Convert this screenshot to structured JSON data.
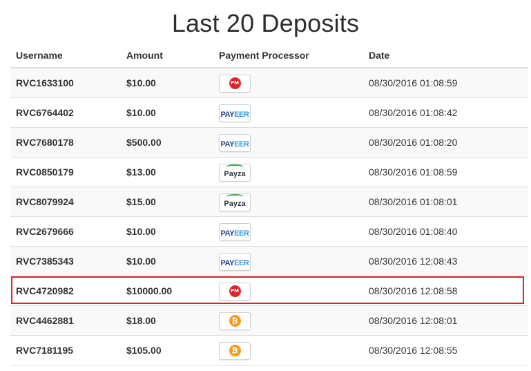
{
  "page": {
    "title": "Last 20 Deposits"
  },
  "table": {
    "headers": {
      "username": "Username",
      "amount": "Amount",
      "processor": "Payment Processor",
      "date": "Date"
    },
    "rows": [
      {
        "username": "RVC1633100",
        "amount": "$10.00",
        "processor": "pm",
        "date": "08/30/2016 01:08:59"
      },
      {
        "username": "RVC6764402",
        "amount": "$10.00",
        "processor": "payeer",
        "date": "08/30/2016 01:08:42"
      },
      {
        "username": "RVC7680178",
        "amount": "$500.00",
        "processor": "payeer",
        "date": "08/30/2016 01:08:20"
      },
      {
        "username": "RVC0850179",
        "amount": "$13.00",
        "processor": "payza",
        "date": "08/30/2016 01:08:59"
      },
      {
        "username": "RVC8079924",
        "amount": "$15.00",
        "processor": "payza",
        "date": "08/30/2016 01:08:01"
      },
      {
        "username": "RVC2679666",
        "amount": "$10.00",
        "processor": "payeer",
        "date": "08/30/2016 01:08:40"
      },
      {
        "username": "RVC7385343",
        "amount": "$10.00",
        "processor": "payeer",
        "date": "08/30/2016 12:08:43"
      },
      {
        "username": "RVC4720982",
        "amount": "$10000.00",
        "processor": "pm",
        "date": "08/30/2016 12:08:58"
      },
      {
        "username": "RVC4462881",
        "amount": "$18.00",
        "processor": "bitcoin",
        "date": "08/30/2016 12:08:01"
      },
      {
        "username": "RVC7181195",
        "amount": "$105.00",
        "processor": "bitcoin",
        "date": "08/30/2016 12:08:55"
      }
    ]
  },
  "processor_logos": {
    "pm": {
      "icon": "perfect-money-logo-icon",
      "text": "PM",
      "color": "#e0232b"
    },
    "payeer": {
      "icon": "payeer-logo-icon",
      "text_a": "PAY",
      "text_b": "EER",
      "color_a": "#1f3f7c",
      "color_b": "#2e9be4"
    },
    "payza": {
      "icon": "payza-logo-icon",
      "text": "Payza",
      "color": "#3aa652"
    },
    "bitcoin": {
      "icon": "bitcoin-logo-icon",
      "text": "₿",
      "color": "#f59a23"
    }
  },
  "highlight": {
    "row_index": 7,
    "color": "#d9232e"
  }
}
